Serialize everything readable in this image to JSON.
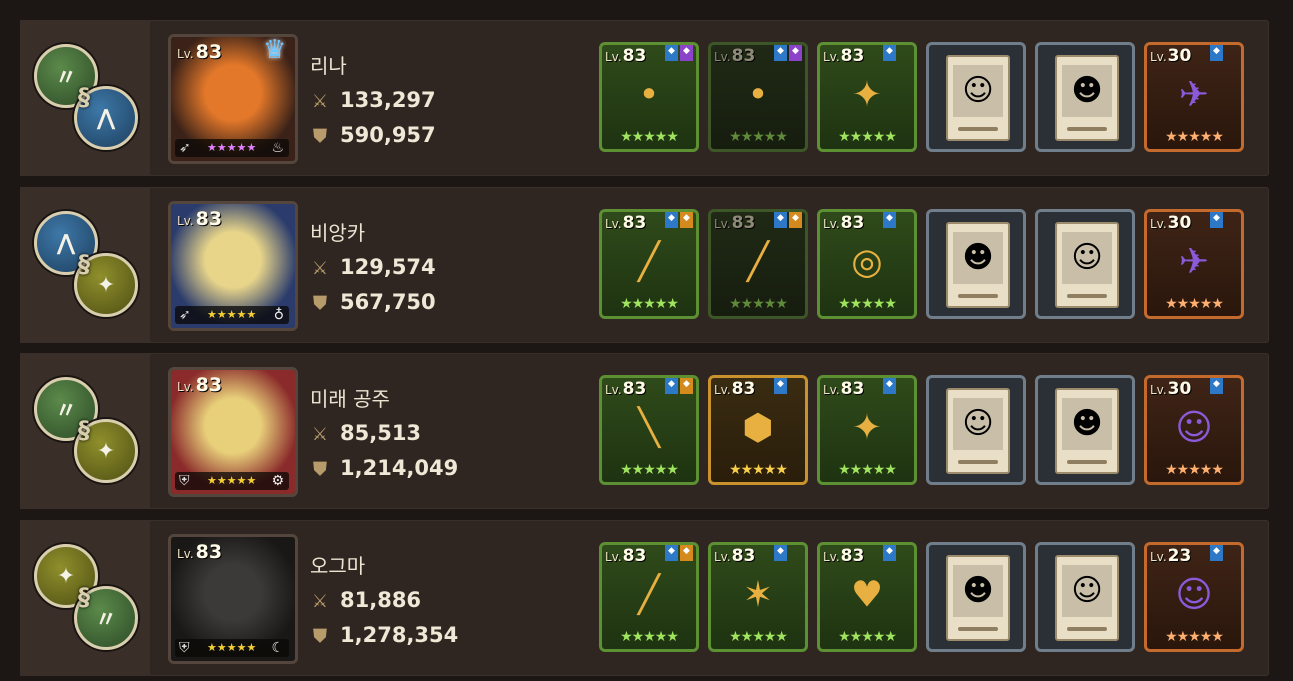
{
  "rows": [
    {
      "name": "리나",
      "level": "83",
      "attack": "133,297",
      "defense": "590,957",
      "chain": {
        "first": "green",
        "second": "blue"
      },
      "crown": true,
      "star_color": "pink",
      "element_icon": "fire-icon",
      "class_icon": "bow-icon",
      "items": [
        {
          "type": "weapon",
          "level": "83",
          "dim": false,
          "flag": "purple",
          "art": "•"
        },
        {
          "type": "weapon",
          "level": "83",
          "dim": true,
          "flag": "purple",
          "art": "•"
        },
        {
          "type": "accessory",
          "level": "83",
          "dim": false,
          "flag": "blue",
          "art": "✦"
        },
        {
          "type": "card",
          "art": "☺"
        },
        {
          "type": "card",
          "art": "☻"
        },
        {
          "type": "pet",
          "level": "30",
          "flag": "blue",
          "art": "✈"
        }
      ]
    },
    {
      "name": "비앙카",
      "level": "83",
      "attack": "129,574",
      "defense": "567,750",
      "chain": {
        "first": "blue",
        "second": "olive"
      },
      "crown": false,
      "star_color": "gold",
      "element_icon": "water-icon",
      "class_icon": "bow-icon",
      "items": [
        {
          "type": "weapon",
          "level": "83",
          "dim": false,
          "flag": "orange",
          "art": "╱"
        },
        {
          "type": "weapon",
          "level": "83",
          "dim": true,
          "flag": "orange",
          "art": "╱"
        },
        {
          "type": "accessory",
          "level": "83",
          "dim": false,
          "flag": "blue",
          "art": "◎"
        },
        {
          "type": "card",
          "art": "☻"
        },
        {
          "type": "card",
          "art": "☺"
        },
        {
          "type": "pet",
          "level": "30",
          "flag": "blue",
          "art": "✈"
        }
      ]
    },
    {
      "name": "미래 공주",
      "level": "83",
      "attack": "85,513",
      "defense": "1,214,049",
      "chain": {
        "first": "green",
        "second": "olive"
      },
      "crown": false,
      "star_color": "gold",
      "element_icon": "gear-icon",
      "class_icon": "shield-icon",
      "items": [
        {
          "type": "weapon",
          "level": "83",
          "dim": false,
          "flag": "orange",
          "art": "╲"
        },
        {
          "type": "gold",
          "level": "83",
          "flag": "blue",
          "art": "⬢"
        },
        {
          "type": "accessory",
          "level": "83",
          "dim": false,
          "flag": "blue",
          "art": "✦"
        },
        {
          "type": "card",
          "art": "☺"
        },
        {
          "type": "card",
          "art": "☻"
        },
        {
          "type": "pet",
          "level": "30",
          "flag": "blue",
          "art": "☺"
        }
      ]
    },
    {
      "name": "오그마",
      "level": "83",
      "attack": "81,886",
      "defense": "1,278,354",
      "chain": {
        "first": "olive",
        "second": "green"
      },
      "crown": false,
      "star_color": "gold",
      "element_icon": "moon-icon",
      "class_icon": "shield-icon",
      "items": [
        {
          "type": "weapon",
          "level": "83",
          "dim": false,
          "flag": "orange",
          "art": "╱"
        },
        {
          "type": "weapon",
          "level": "83",
          "dim": false,
          "flag": null,
          "art": "✶"
        },
        {
          "type": "accessory",
          "level": "83",
          "dim": false,
          "flag": "blue",
          "art": "♥"
        },
        {
          "type": "card",
          "art": "☻"
        },
        {
          "type": "card",
          "art": "☺"
        },
        {
          "type": "pet",
          "level": "23",
          "flag": "blue",
          "art": "☺"
        }
      ]
    }
  ],
  "labels": {
    "lv": "Lv.",
    "stars": "★★★★★",
    "item_stars": "★★★★★"
  },
  "colors": {
    "row_bg": "#2f2621",
    "text": "#f0e8d6",
    "gold": "#f4cf37"
  }
}
